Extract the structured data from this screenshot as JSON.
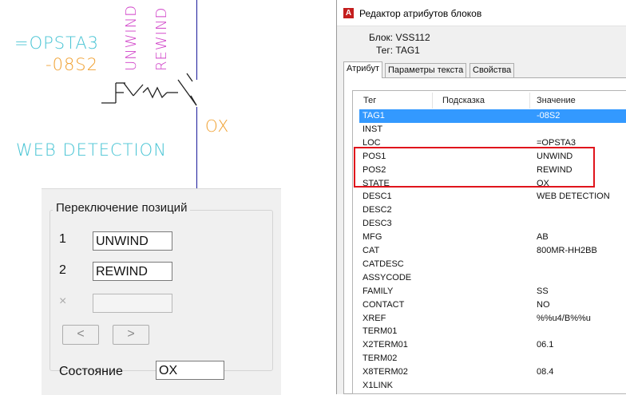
{
  "cad": {
    "loc_text": "=OPSTA3",
    "tag_text": "-08S2",
    "pos1_text": "UNWIND",
    "pos2_text": "REWIND",
    "state_text": "OX",
    "desc_text": "WEB DETECTION",
    "colors": {
      "cyan": "#48c4d4",
      "orange": "#f0a030",
      "magenta": "#d040c8",
      "line": "#1a1a9a"
    }
  },
  "positions_panel": {
    "title": "Переключение позиций",
    "rows": [
      {
        "label": "1",
        "value": "UNWIND"
      },
      {
        "label": "2",
        "value": "REWIND"
      },
      {
        "label": "×",
        "value": ""
      }
    ],
    "prev_button": "<",
    "next_button": ">",
    "state_label": "Состояние",
    "state_value": "OX"
  },
  "dialog": {
    "title": "Редактор атрибутов блоков",
    "block_line": "Блок: VSS112",
    "tag_line": "Тег: TAG1",
    "tabs": [
      "Атрибут",
      "Параметры текста",
      "Свойства"
    ],
    "columns": {
      "tag": "Тег",
      "prompt": "Подсказка",
      "value": "Значение"
    },
    "rows": [
      {
        "tag": "TAG1",
        "value": "-08S2",
        "selected": true
      },
      {
        "tag": "INST",
        "value": ""
      },
      {
        "tag": "LOC",
        "value": "=OPSTA3"
      },
      {
        "tag": "POS1",
        "value": "UNWIND"
      },
      {
        "tag": "POS2",
        "value": "REWIND"
      },
      {
        "tag": "STATE",
        "value": "OX"
      },
      {
        "tag": "DESC1",
        "value": "WEB DETECTION"
      },
      {
        "tag": "DESC2",
        "value": ""
      },
      {
        "tag": "DESC3",
        "value": ""
      },
      {
        "tag": "MFG",
        "value": "AB"
      },
      {
        "tag": "CAT",
        "value": "800MR-HH2BB"
      },
      {
        "tag": "CATDESC",
        "value": ""
      },
      {
        "tag": "ASSYCODE",
        "value": ""
      },
      {
        "tag": "FAMILY",
        "value": "SS"
      },
      {
        "tag": "CONTACT",
        "value": "NO"
      },
      {
        "tag": "XREF",
        "value": "%%u4/B%%u"
      },
      {
        "tag": "TERM01",
        "value": ""
      },
      {
        "tag": "X2TERM01",
        "value": "06.1"
      },
      {
        "tag": "TERM02",
        "value": ""
      },
      {
        "tag": "X8TERM02",
        "value": "08.4"
      },
      {
        "tag": "X1LINK",
        "value": ""
      }
    ],
    "highlight_color": "#e0141c"
  }
}
